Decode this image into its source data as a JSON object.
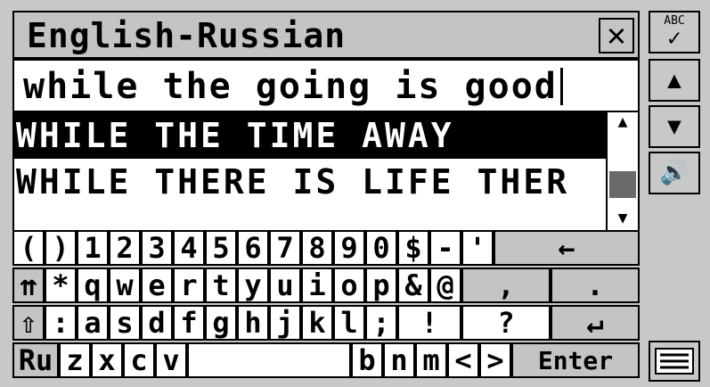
{
  "title": "English-Russian",
  "close_icon": "close-x-icon",
  "input": {
    "value": "while the going is good"
  },
  "results": [
    "WHILE THE TIME AWAY",
    "WHILE THERE IS LIFE THER"
  ],
  "side_buttons": {
    "spell": "ABC",
    "up": "▲",
    "down": "▼",
    "sound": "🔊"
  },
  "keyboard": {
    "row1": [
      "(",
      ")",
      "1",
      "2",
      "3",
      "4",
      "5",
      "6",
      "7",
      "8",
      "9",
      "0",
      "$",
      "-",
      "'",
      "←"
    ],
    "row2": [
      "⇈",
      "*",
      "q",
      "w",
      "e",
      "r",
      "t",
      "y",
      "u",
      "i",
      "o",
      "p",
      "&",
      "@",
      ",",
      "."
    ],
    "row3": [
      "⇧",
      ":",
      "a",
      "s",
      "d",
      "f",
      "g",
      "h",
      "j",
      "k",
      "l",
      ";",
      "!",
      "?",
      "↵"
    ],
    "row4": [
      "Ru",
      "z",
      "x",
      "c",
      "v",
      "",
      "b",
      "n",
      "m",
      "<",
      ">",
      "Enter"
    ]
  }
}
